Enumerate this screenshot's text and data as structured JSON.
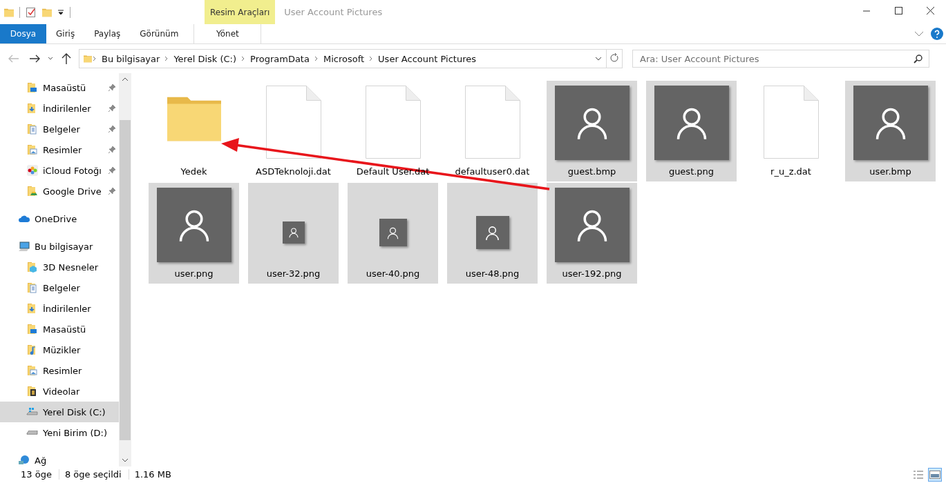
{
  "window": {
    "title": "User Account Pictures",
    "context_group": "Resim Araçları"
  },
  "ribbon": {
    "tabs": [
      {
        "label": "Dosya",
        "kind": "file",
        "selected": false
      },
      {
        "label": "Giriş",
        "kind": "tab",
        "selected": false
      },
      {
        "label": "Paylaş",
        "kind": "tab",
        "selected": false
      },
      {
        "label": "Görünüm",
        "kind": "tab",
        "selected": false
      },
      {
        "label": "Yönet",
        "kind": "context",
        "selected": false
      }
    ]
  },
  "address_bar": {
    "crumbs": [
      "Bu bilgisayar",
      "Yerel Disk (C:)",
      "ProgramData",
      "Microsoft",
      "User Account Pictures"
    ]
  },
  "search": {
    "placeholder": "Ara: User Account Pictures"
  },
  "sidebar": {
    "pinned_items": [
      {
        "label": "Masaüstü",
        "kind": "desktop",
        "pinned": true,
        "selected": false
      },
      {
        "label": "İndirilenler",
        "kind": "downloads",
        "pinned": true,
        "selected": false
      },
      {
        "label": "Belgeler",
        "kind": "documents",
        "pinned": true,
        "selected": false
      },
      {
        "label": "Resimler",
        "kind": "pictures",
        "pinned": true,
        "selected": false
      },
      {
        "label": "iCloud Fotoğı",
        "kind": "photos",
        "pinned": true,
        "selected": false
      },
      {
        "label": "Google Drive",
        "kind": "gdrive",
        "pinned": true,
        "selected": false
      }
    ],
    "items": [
      {
        "label": "OneDrive",
        "kind": "cloud",
        "selected": false
      },
      {
        "label": "Bu bilgisayar",
        "kind": "pc",
        "selected": false,
        "children": [
          {
            "label": "3D Nesneler",
            "kind": "objects3d",
            "selected": false
          },
          {
            "label": "Belgeler",
            "kind": "documents",
            "selected": false
          },
          {
            "label": "İndirilenler",
            "kind": "downloads",
            "selected": false
          },
          {
            "label": "Masaüstü",
            "kind": "desktop",
            "selected": false
          },
          {
            "label": "Müzikler",
            "kind": "music",
            "selected": false
          },
          {
            "label": "Resimler",
            "kind": "pictures",
            "selected": false
          },
          {
            "label": "Videolar",
            "kind": "videos",
            "selected": false
          },
          {
            "label": "Yerel Disk (C:)",
            "kind": "systemdisk",
            "selected": true
          },
          {
            "label": "Yeni Birim (D:)",
            "kind": "disk",
            "selected": false
          }
        ]
      },
      {
        "label": "Ağ",
        "kind": "network",
        "selected": false
      }
    ]
  },
  "files": [
    {
      "name": "Yedek",
      "kind": "folder",
      "selected": false
    },
    {
      "name": "ASDTeknoloji.dat",
      "kind": "file",
      "selected": false
    },
    {
      "name": "Default User.dat",
      "kind": "file",
      "selected": false
    },
    {
      "name": "defaultuser0.dat",
      "kind": "file",
      "selected": false
    },
    {
      "name": "guest.bmp",
      "kind": "image",
      "selected": true
    },
    {
      "name": "guest.png",
      "kind": "image",
      "selected": true
    },
    {
      "name": "r_u_z.dat",
      "kind": "file",
      "selected": false
    },
    {
      "name": "user.bmp",
      "kind": "image",
      "selected": true
    },
    {
      "name": "user.png",
      "kind": "image",
      "selected": true
    },
    {
      "name": "user-32.png",
      "kind": "image32",
      "selected": true
    },
    {
      "name": "user-40.png",
      "kind": "image40",
      "selected": true
    },
    {
      "name": "user-48.png",
      "kind": "image48",
      "selected": true
    },
    {
      "name": "user-192.png",
      "kind": "image",
      "selected": true
    }
  ],
  "status_bar": {
    "item_count": "13 öge",
    "selection": "8 öge seçildi",
    "size": "1.16 MB"
  },
  "views": [
    {
      "kind": "details",
      "selected": false
    },
    {
      "kind": "large_icons",
      "selected": true
    }
  ]
}
